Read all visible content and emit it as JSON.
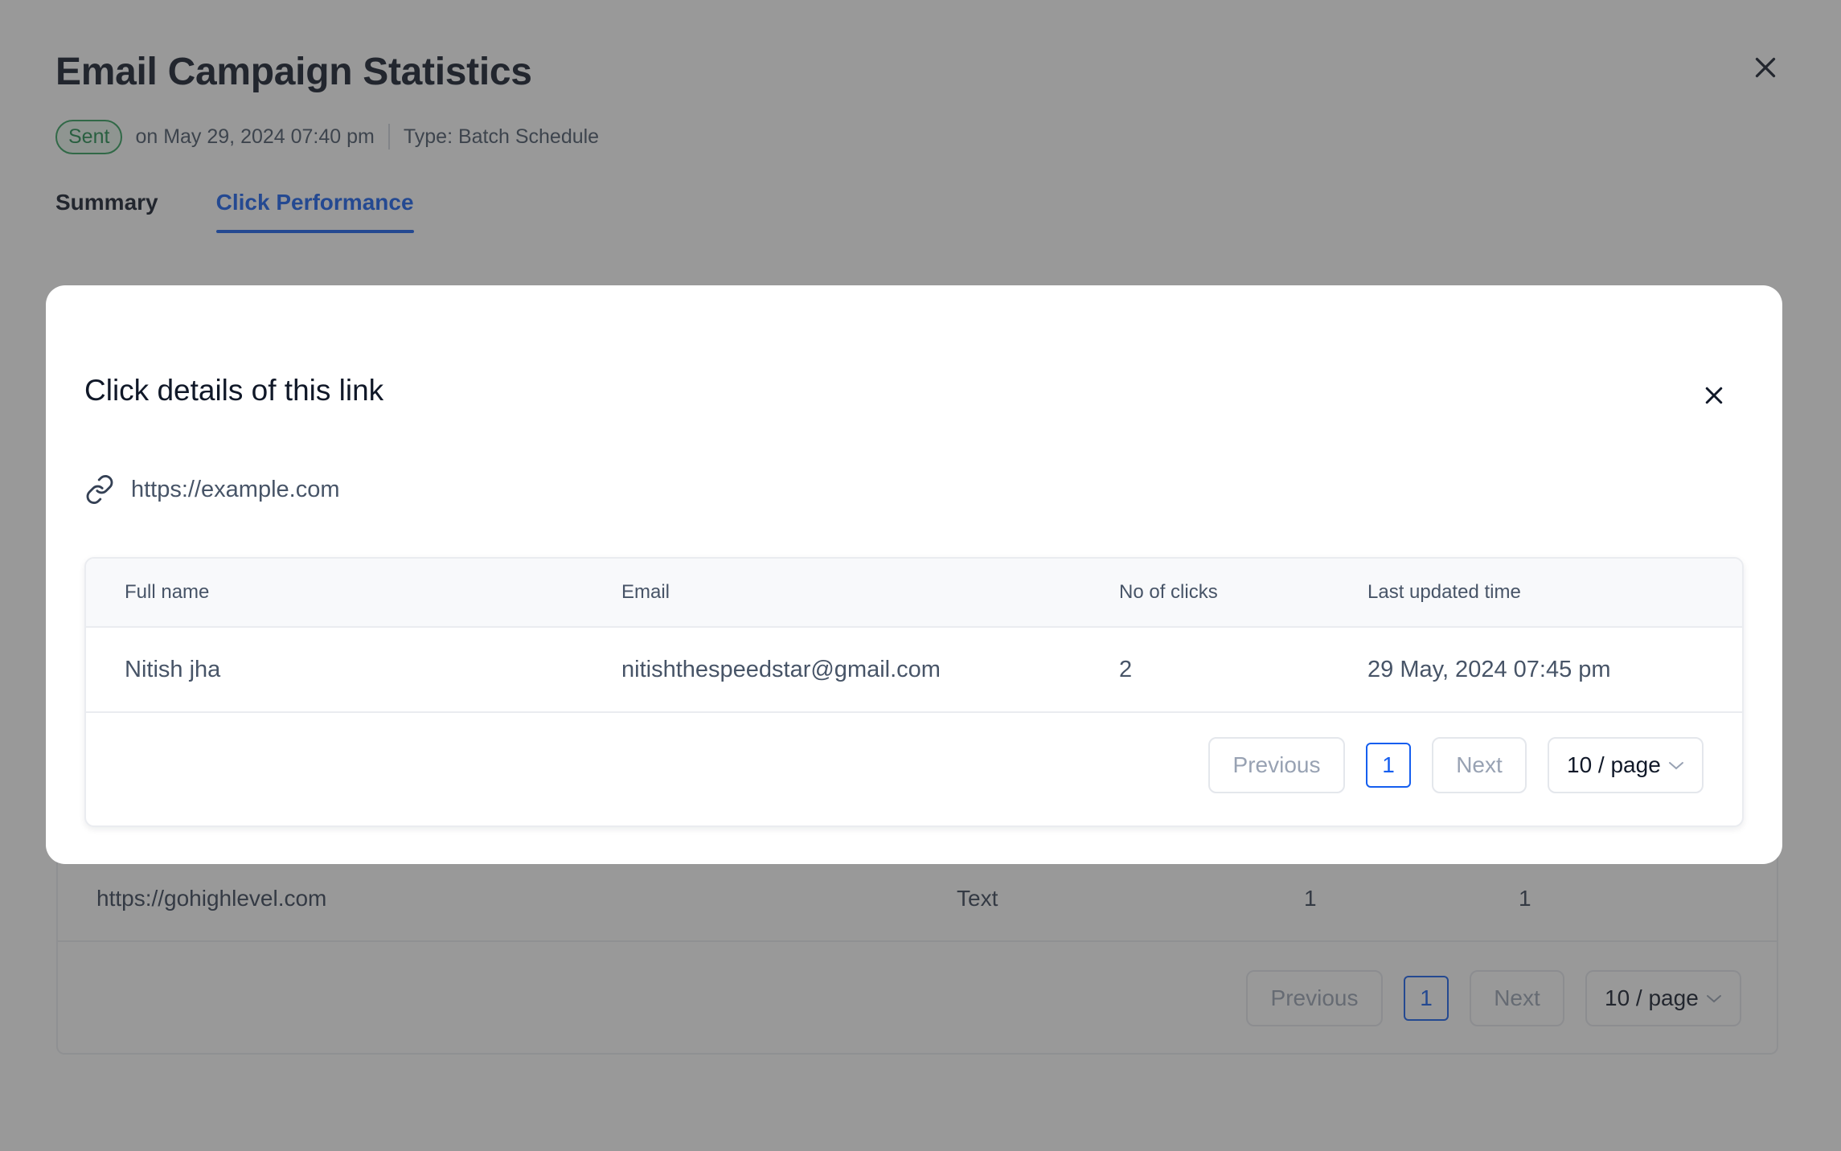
{
  "background": {
    "title": "Email Campaign Statistics",
    "status": "Sent",
    "sent_on": "on May 29, 2024 07:40 pm",
    "type": "Type: Batch Schedule",
    "tabs": [
      {
        "label": "Summary",
        "active": false
      },
      {
        "label": "Click Performance",
        "active": true
      }
    ],
    "table_row": {
      "url": "https://gohighlevel.com",
      "type": "Text",
      "col3": "1",
      "col4": "1"
    },
    "pagination": {
      "previous": "Previous",
      "page": "1",
      "next": "Next",
      "page_size": "10 / page"
    }
  },
  "modal": {
    "title": "Click details of this link",
    "link_icon": "link-icon",
    "link_url": "https://example.com",
    "table": {
      "columns": [
        "Full name",
        "Email",
        "No of clicks",
        "Last updated time"
      ],
      "rows": [
        [
          "Nitish jha",
          "nitishthespeedstar@gmail.com",
          "2",
          "29 May, 2024 07:45 pm"
        ]
      ]
    },
    "pagination": {
      "previous": "Previous",
      "page": "1",
      "next": "Next",
      "page_size": "10 / page"
    }
  },
  "colors": {
    "accent": "#155eef",
    "success": "#1f8a4c",
    "text_primary": "#101828",
    "text_secondary": "#475467",
    "overlay": "rgba(52,52,52,0.5)"
  }
}
